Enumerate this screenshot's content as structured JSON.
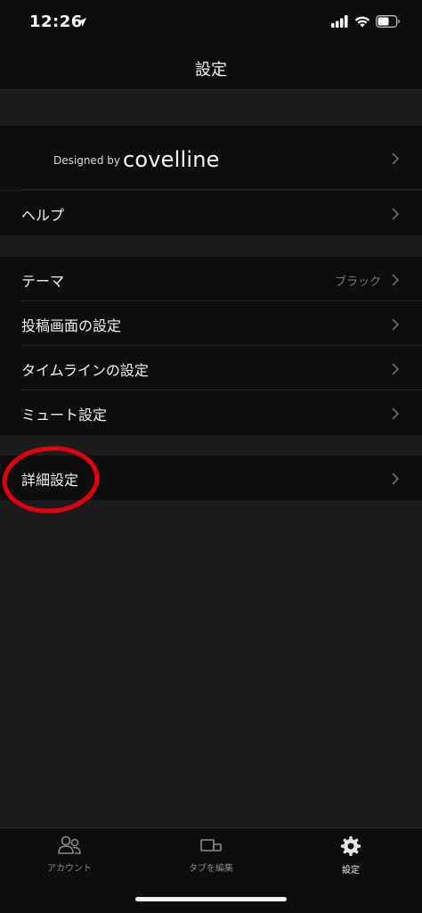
{
  "status": {
    "time": "12:26"
  },
  "nav": {
    "title": "設定"
  },
  "sections": [
    {
      "brand_row": {
        "designed_by": "Designed by",
        "brand": "covelline"
      },
      "items": [
        {
          "label": "ヘルプ"
        }
      ]
    },
    {
      "items": [
        {
          "label": "テーマ",
          "value": "ブラック"
        },
        {
          "label": "投稿画面の設定"
        },
        {
          "label": "タイムラインの設定"
        },
        {
          "label": "ミュート設定"
        }
      ]
    },
    {
      "items": [
        {
          "label": "詳細設定"
        }
      ]
    }
  ],
  "annotation": {
    "color": "#e0000f",
    "target": "詳細設定"
  },
  "tabbar": {
    "tabs": [
      {
        "label": "アカウント",
        "icon": "people-icon",
        "active": false
      },
      {
        "label": "タブを編集",
        "icon": "tabs-edit-icon",
        "active": false
      },
      {
        "label": "設定",
        "icon": "gear-icon",
        "active": true
      }
    ]
  }
}
